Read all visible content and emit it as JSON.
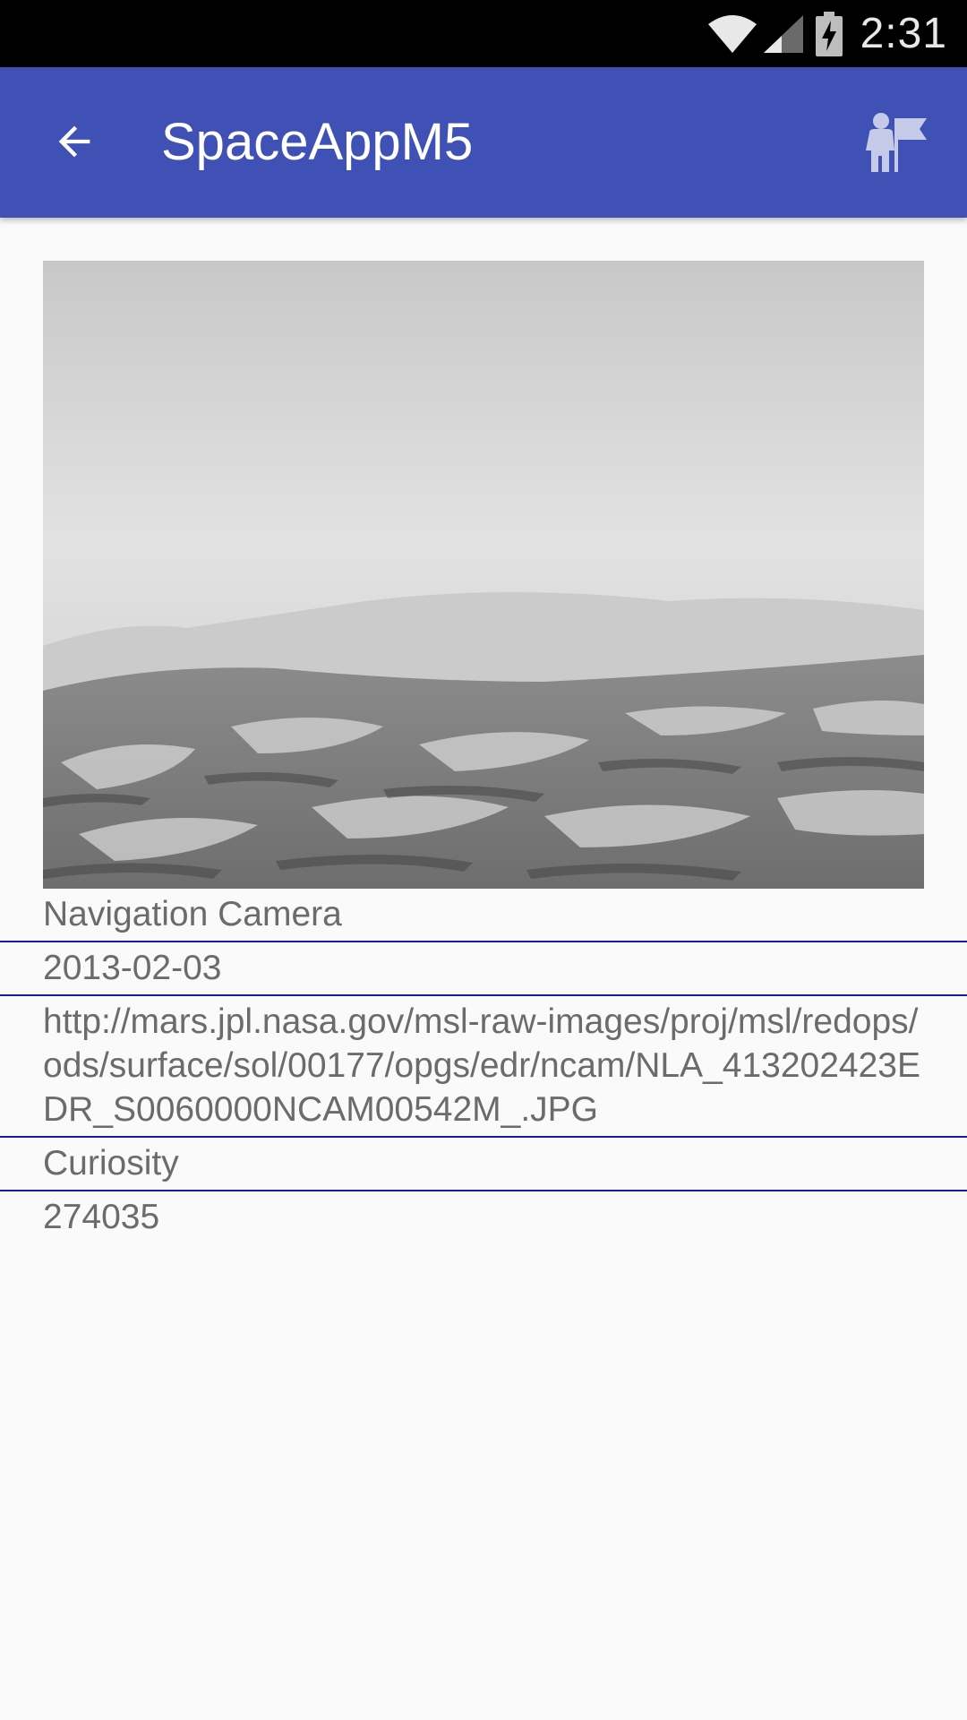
{
  "status_bar": {
    "time": "2:31",
    "icons": [
      "wifi-icon",
      "cellular-signal-icon",
      "battery-charging-icon"
    ]
  },
  "app_bar": {
    "title": "SpaceAppM5",
    "back_icon": "arrow-back-icon",
    "action_icon": "astronaut-flag-icon",
    "color": "#3f51b5"
  },
  "photo": {
    "icon": "mars-terrain-photo"
  },
  "details": {
    "camera": "Navigation Camera",
    "earth_date": "2013-02-03",
    "img_src": "http://mars.jpl.nasa.gov/msl-raw-images/proj/msl/redops/ods/surface/sol/00177/opgs/edr/ncam/NLA_413202423EDR_S0060000NCAM00542M_.JPG",
    "rover": "Curiosity",
    "id": "274035"
  },
  "colors": {
    "divider": "#1a1aa8",
    "text": "#6b6b6b",
    "background": "#fafafa"
  }
}
